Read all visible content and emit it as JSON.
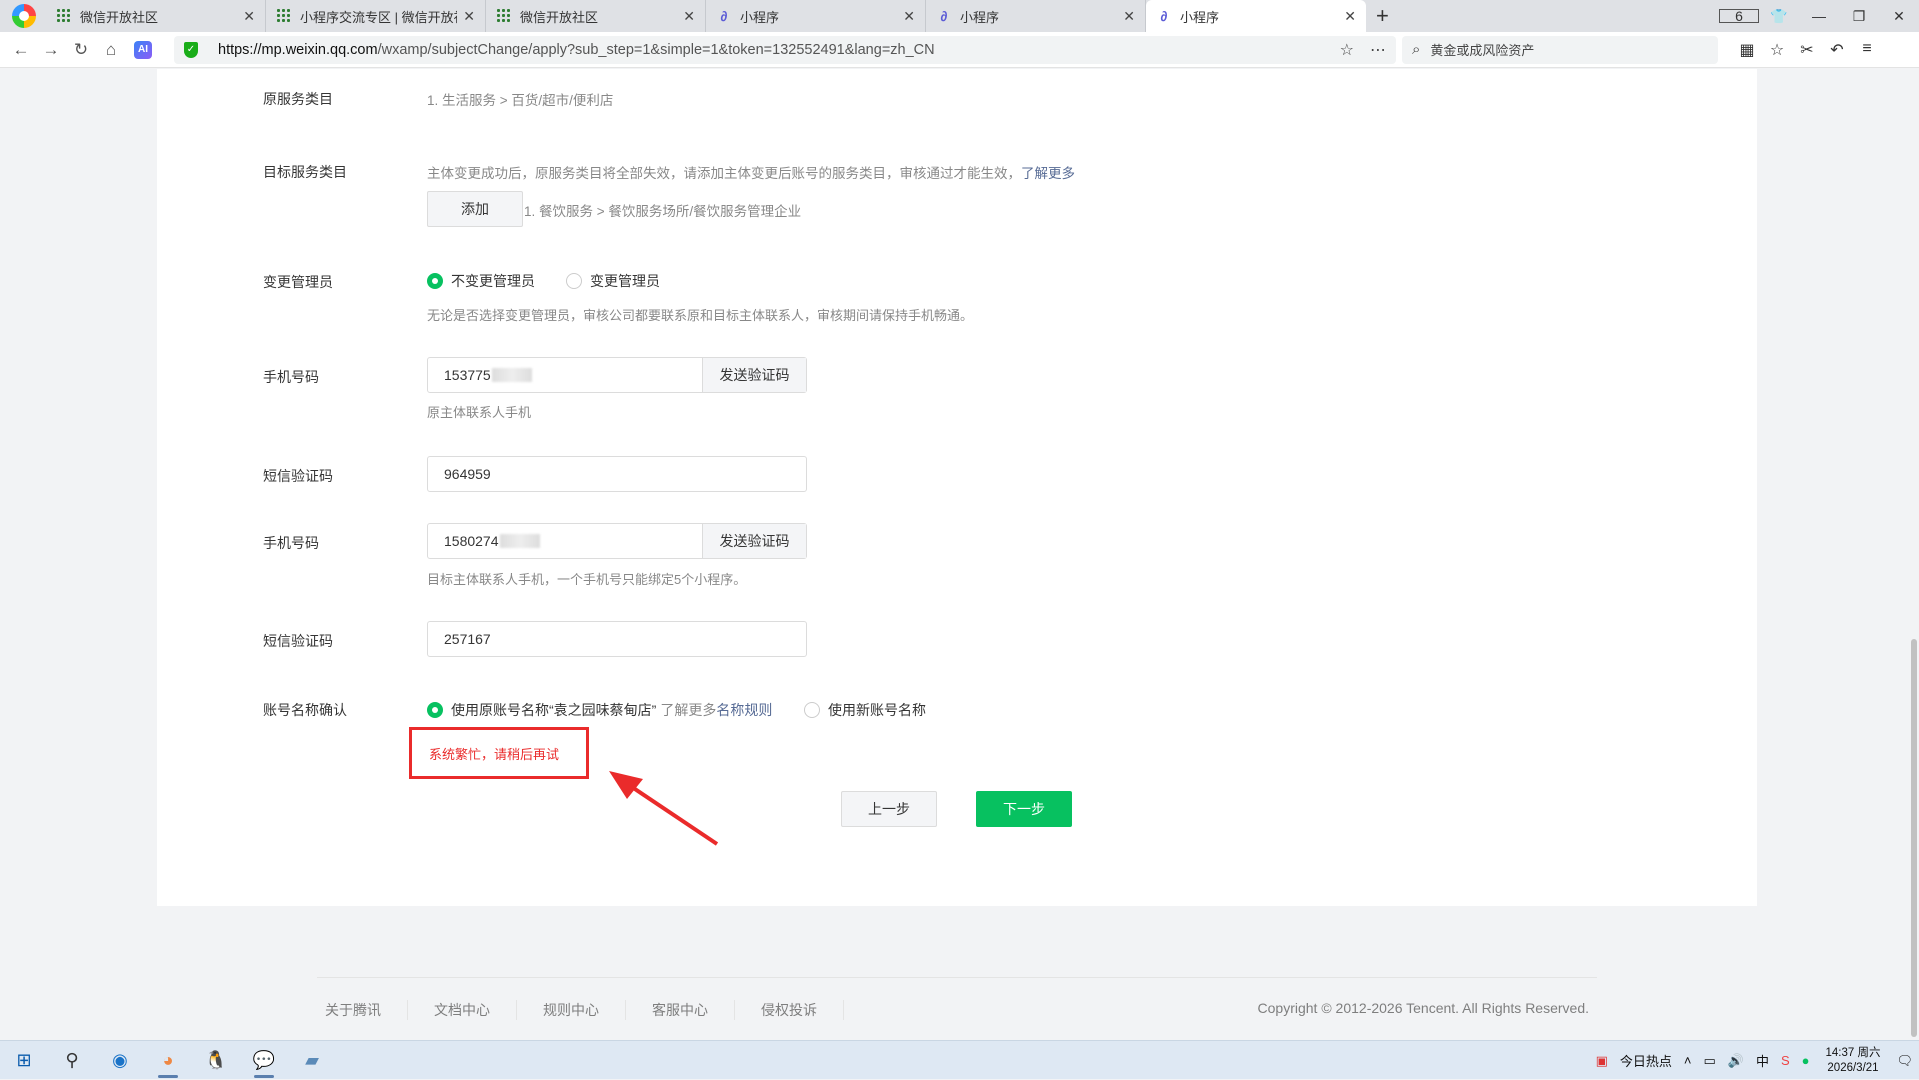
{
  "browser": {
    "tabs": [
      {
        "title": "微信开放社区",
        "icon": "grid-icon"
      },
      {
        "title": "小程序交流专区 | 微信开放社",
        "icon": "grid-icon"
      },
      {
        "title": "微信开放社区",
        "icon": "grid-icon"
      },
      {
        "title": "小程序",
        "icon": "miniprogram-icon"
      },
      {
        "title": "小程序",
        "icon": "miniprogram-icon"
      },
      {
        "title": "小程序",
        "icon": "miniprogram-icon",
        "active": true
      }
    ],
    "tab_count": "6",
    "url_host": "https://mp.weixin.qq.com",
    "url_path": "/wxamp/subjectChange/apply?sub_step=1&simple=1&token=132552491&lang=zh_CN",
    "search_text": "黄金或成风险资产"
  },
  "form": {
    "orig_category_label": "原服务类目",
    "orig_category_value": "1. 生活服务 > 百货/超市/便利店",
    "target_category_label": "目标服务类目",
    "target_category_note": "主体变更成功后，原服务类目将全部失效，请添加主体变更后账号的服务类目，审核通过才能生效，",
    "learn_more": "了解更多",
    "add_button": "添加",
    "target_category_value": "1. 餐饮服务 > 餐饮服务场所/餐饮服务管理企业",
    "admin_label": "变更管理员",
    "admin_opt_keep": "不变更管理员",
    "admin_opt_change": "变更管理员",
    "admin_hint": "无论是否选择变更管理员，审核公司都要联系原和目标主体联系人，审核期间请保持手机畅通。",
    "phone1_label": "手机号码",
    "phone1_value": "153775",
    "send_code": "发送验证码",
    "phone1_hint": "原主体联系人手机",
    "sms1_label": "短信验证码",
    "sms1_value": "964959",
    "phone2_label": "手机号码",
    "phone2_value": "1580274",
    "phone2_hint": "目标主体联系人手机，一个手机号只能绑定5个小程序。",
    "sms2_label": "短信验证码",
    "sms2_value": "257167",
    "name_label": "账号名称确认",
    "name_opt_keep": "使用原账号名称“袁之园味蔡甸店”",
    "name_learn_more": "了解更多",
    "name_rules": "名称规则",
    "name_opt_new": "使用新账号名称",
    "error_text": "系统繁忙，请稍后再试",
    "prev_button": "上一步",
    "next_button": "下一步"
  },
  "footer": {
    "links": [
      "关于腾讯",
      "文档中心",
      "规则中心",
      "客服中心",
      "侵权投诉"
    ],
    "copyright": "Copyright © 2012-2026 Tencent. All Rights Reserved."
  },
  "taskbar": {
    "hot_news": "今日热点",
    "time": "14:37 周六",
    "date": "2026/3/21"
  },
  "colors": {
    "accent": "#07c160",
    "error": "#ea2b2b",
    "link": "#576b95"
  }
}
